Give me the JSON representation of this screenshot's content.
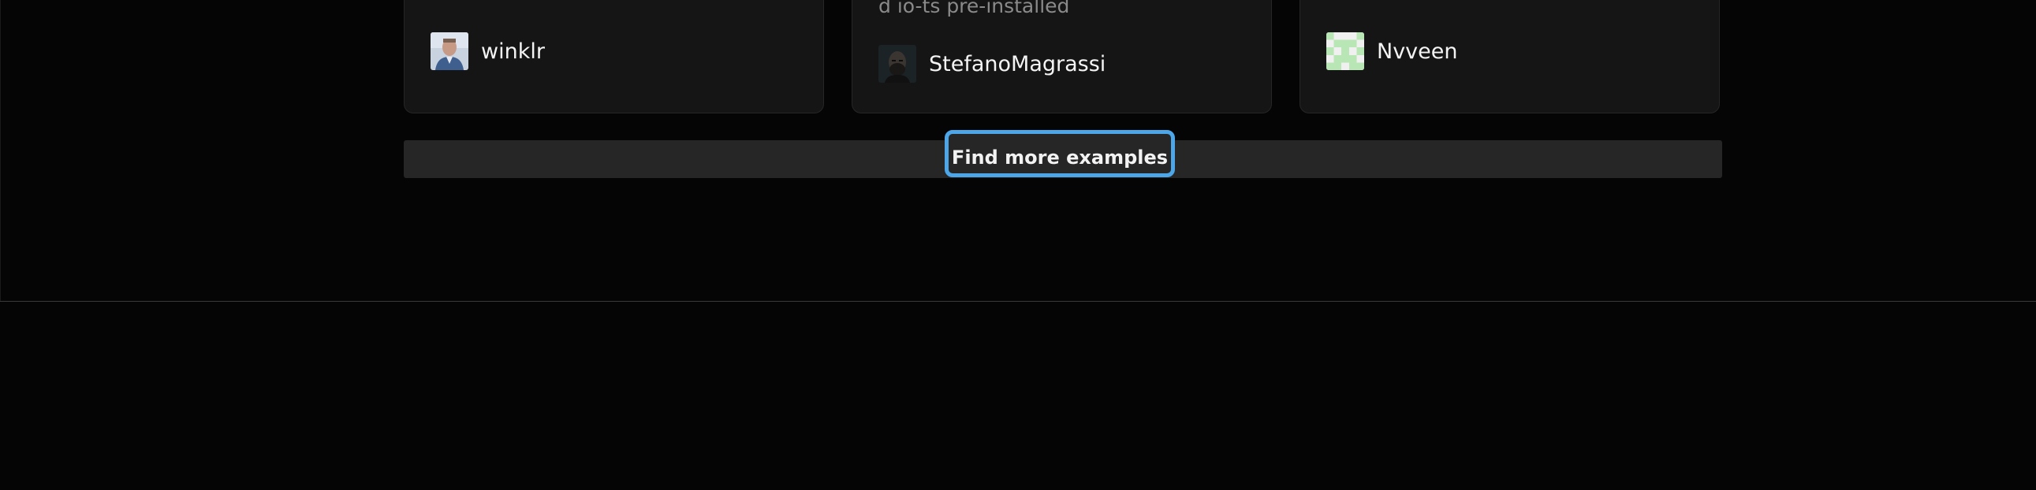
{
  "cards": [
    {
      "snippet": "",
      "author": {
        "name": "winklr",
        "avatar_icon": "user-photo-avatar"
      }
    },
    {
      "snippet": "d   io-ts   pre-installed",
      "author": {
        "name": "StefanoMagrassi",
        "avatar_icon": "user-photo-avatar"
      }
    },
    {
      "snippet": "",
      "author": {
        "name": "Nvveen",
        "avatar_icon": "identicon-avatar"
      }
    }
  ],
  "more": {
    "label": "Find more examples"
  },
  "colors": {
    "background": "#050505",
    "card": "#151515",
    "focus_ring": "#4da6e8",
    "identicon": "#b9e6b5"
  }
}
